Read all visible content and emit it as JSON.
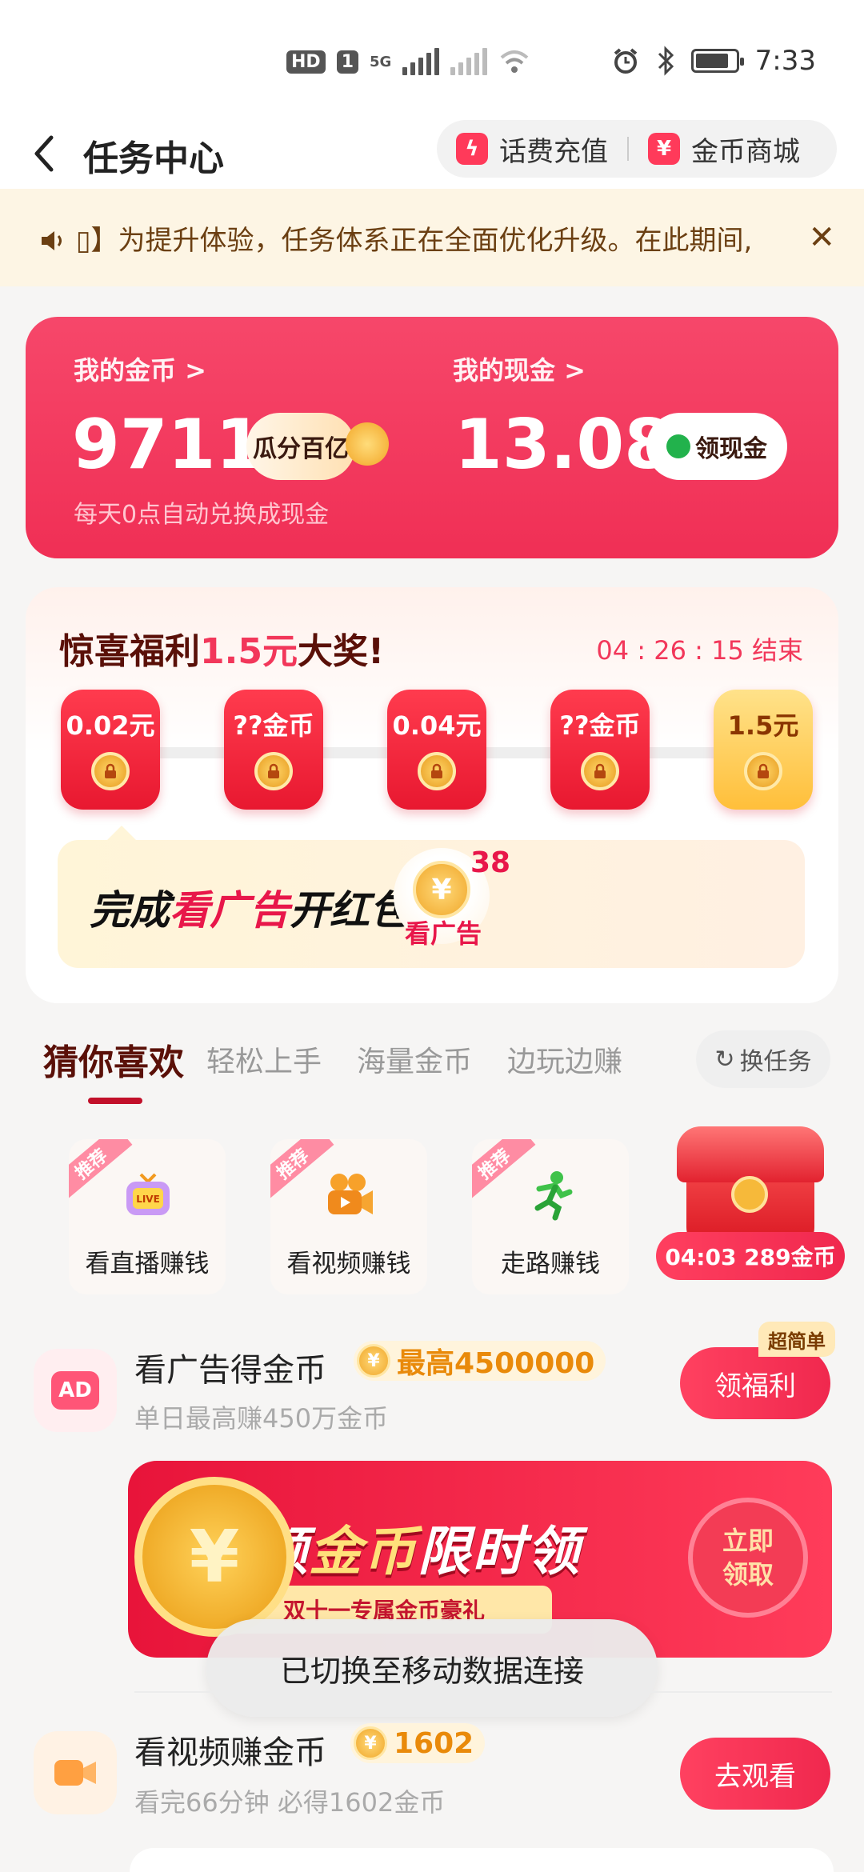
{
  "status_bar": {
    "badge_hd": "HD",
    "badge_sim": "1",
    "network": "5G",
    "time": "7:33"
  },
  "header": {
    "title": "任务中心",
    "recharge_label": "话费充值",
    "mall_label": "金币商城"
  },
  "notice": {
    "icon": "speaker-icon",
    "text": "为提升体验，任务体系正在全面优化升级。在此期间,"
  },
  "wallet": {
    "coins_label": "我的金币 >",
    "coins_value": "9711",
    "coins_pill": "瓜分百亿",
    "cash_label": "我的现金 >",
    "cash_value": "13.08",
    "cash_pill": "领现金",
    "note": "每天0点自动兑换成现金",
    "colors": {
      "card": "#f6476a",
      "accent": "#f2375a"
    }
  },
  "surprise": {
    "title_a": "惊喜福利",
    "title_b": "1.5元",
    "title_c": "大奖!",
    "timer": "04 : 26 : 15  结束",
    "packets": [
      {
        "value": "0.02元",
        "type": "red"
      },
      {
        "value": "??金币",
        "type": "red"
      },
      {
        "value": "0.04元",
        "type": "red"
      },
      {
        "value": "??金币",
        "type": "red"
      },
      {
        "value": "1.5元",
        "type": "gold"
      }
    ],
    "banner_a": "完成",
    "banner_b": "看广告",
    "banner_c": "开红包",
    "coin_count": "38",
    "coin_label": "看广告"
  },
  "tabs": {
    "items": [
      "猜你喜欢",
      "轻松上手",
      "海量金币",
      "边玩边赚"
    ],
    "active": 0,
    "swap_label": "换任务"
  },
  "quick_tasks": [
    {
      "badge": "推荐",
      "label": "看直播赚钱",
      "icon": "live-tv-icon"
    },
    {
      "badge": "推荐",
      "label": "看视频赚钱",
      "icon": "video-camera-icon"
    },
    {
      "badge": "推荐",
      "label": "走路赚钱",
      "icon": "running-person-icon"
    }
  ],
  "chest": {
    "label": "04:03 289金币",
    "icon": "treasure-chest-icon"
  },
  "tasks": [
    {
      "title": "看广告得金币",
      "reward": "最高4500000",
      "sub": "单日最高赚450万金币",
      "button": "领福利",
      "tag": "超简单",
      "icon": "AD"
    },
    {
      "title": "看视频赚金币",
      "reward": "1602",
      "sub": "看完66分钟 必得1602金币",
      "button": "去观看",
      "icon": "video-icon"
    }
  ],
  "promo": {
    "title_a": "大额",
    "title_b": "金币",
    "title_c": "限时领",
    "subtitle": "双十一专属金币豪礼",
    "cta": "立即领取",
    "coin_symbol": "¥"
  },
  "toast": "已切换至移动数据连接"
}
